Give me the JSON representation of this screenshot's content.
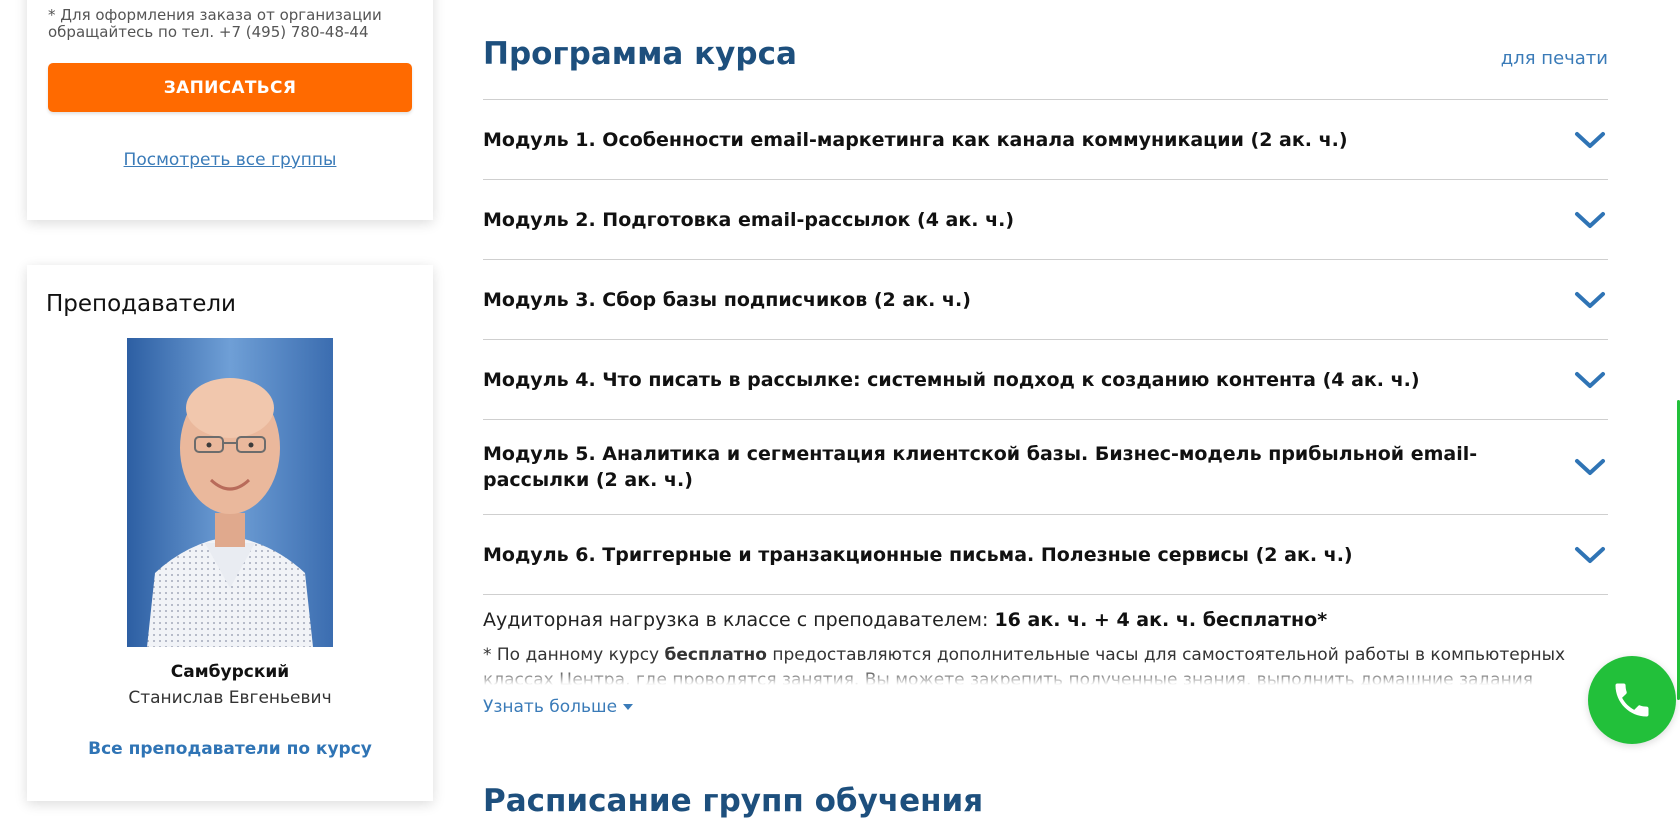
{
  "order_card": {
    "org_note": "* Для оформления заказа от организации обращайтесь по тел. +7 (495) 780-48-44",
    "enroll_label": "ЗАПИСАТЬСЯ",
    "all_groups_label": "Посмотреть все группы"
  },
  "teachers": {
    "title": "Преподаватели",
    "teacher": {
      "surname": "Самбурский",
      "given_names": "Станислав Евгеньевич"
    },
    "all_teachers_label": "Все преподаватели по курсу"
  },
  "program": {
    "title": "Программа курса",
    "print_label": "для печати",
    "modules": [
      {
        "title": "Модуль 1. Особенности email-маркетинга как канала коммуникации  (2 ак. ч.)"
      },
      {
        "title": "Модуль 2. Подготовка email-рассылок  (4 ак. ч.)"
      },
      {
        "title": "Модуль 3. Сбор базы подписчиков  (2 ак. ч.)"
      },
      {
        "title": "Модуль 4. Что писать в рассылке: системный подход к созданию контента  (4 ак. ч.)"
      },
      {
        "title": "Модуль 5. Аналитика и сегментация клиентской базы. Бизнес-модель прибыльной email-рассылки  (2 ак. ч.)"
      },
      {
        "title": "Модуль 6. Триггерные и транзакционные письма. Полезные сервисы  (2 ак. ч.)"
      }
    ],
    "hours_label": "Аудиторная нагрузка в классе с преподавателем:",
    "hours_value": "16 ак. ч. + 4 ак. ч. бесплатно*",
    "free_note_prefix": "* По данному курсу",
    "free_note_bold": "бесплатно",
    "free_note_text": "предоставляются дополнительные часы для самостоятельной работы в компьютерных классах Центра, где проводятся занятия. Вы можете закрепить полученные знания, выполнить домашние задания",
    "learn_more_label": "Узнать больше"
  },
  "schedule": {
    "title": "Расписание групп обучения"
  },
  "icons": {
    "module_toggle": "chevron-down-icon",
    "call": "phone-icon"
  },
  "colors": {
    "accent_orange": "#ff6a00",
    "heading_blue": "#1d4f7d",
    "link_blue": "#3a7bb8",
    "call_green": "#22c03a"
  }
}
